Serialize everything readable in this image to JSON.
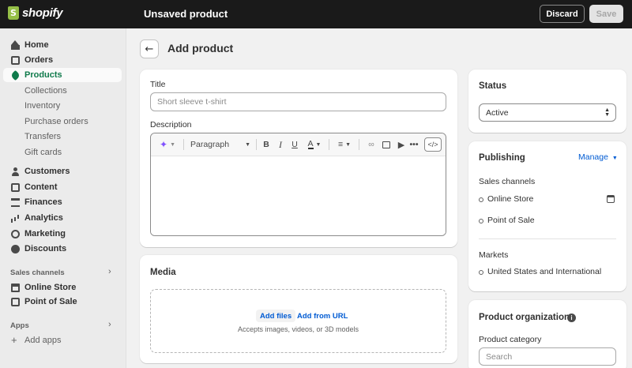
{
  "topbar": {
    "brand": "shopify",
    "title": "Unsaved product",
    "discard_label": "Discard",
    "save_label": "Save"
  },
  "sidebar": {
    "items": [
      {
        "label": "Home",
        "icon": "home-icon"
      },
      {
        "label": "Orders",
        "icon": "orders-icon"
      },
      {
        "label": "Products",
        "icon": "tag-icon",
        "active": true
      },
      {
        "label": "Customers",
        "icon": "person-icon"
      },
      {
        "label": "Content",
        "icon": "content-icon"
      },
      {
        "label": "Finances",
        "icon": "bank-icon"
      },
      {
        "label": "Analytics",
        "icon": "bar-chart-icon"
      },
      {
        "label": "Marketing",
        "icon": "target-icon"
      },
      {
        "label": "Discounts",
        "icon": "discount-icon"
      }
    ],
    "product_subitems": [
      "Collections",
      "Inventory",
      "Purchase orders",
      "Transfers",
      "Gift cards"
    ],
    "sales_channels_label": "Sales channels",
    "channels": [
      {
        "label": "Online Store",
        "icon": "store-icon"
      },
      {
        "label": "Point of Sale",
        "icon": "pos-icon"
      }
    ],
    "apps_label": "Apps",
    "add_apps_label": "Add apps"
  },
  "page": {
    "title": "Add product",
    "back_icon": "arrow-left-icon"
  },
  "product_form": {
    "title_label": "Title",
    "title_placeholder": "Short sleeve t-shirt",
    "description_label": "Description",
    "paragraph_select": "Paragraph"
  },
  "media": {
    "heading": "Media",
    "add_files": "Add files",
    "add_from_url": "Add from URL",
    "hint": "Accepts images, videos, or 3D models"
  },
  "status": {
    "heading": "Status",
    "value": "Active"
  },
  "publishing": {
    "heading": "Publishing",
    "manage_label": "Manage",
    "sales_channels_label": "Sales channels",
    "channels": [
      "Online Store",
      "Point of Sale"
    ],
    "markets_label": "Markets",
    "markets": [
      "United States and International"
    ]
  },
  "organization": {
    "heading": "Product organization",
    "category_label": "Product category",
    "category_placeholder": "Search"
  }
}
